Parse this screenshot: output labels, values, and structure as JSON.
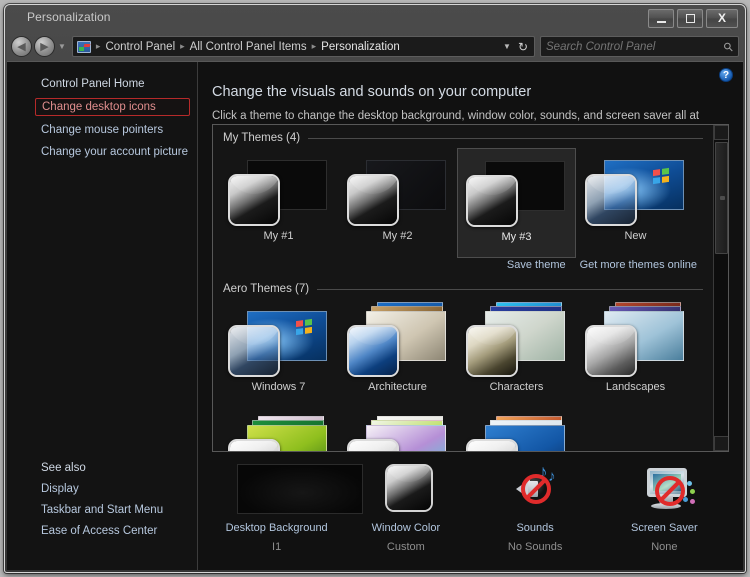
{
  "window": {
    "title": "Personalization",
    "minimize_label": "Minimize",
    "maximize_label": "Maximize",
    "close_label": "Close"
  },
  "address_bar": {
    "back_label": "Back",
    "forward_label": "Forward",
    "recent_pages_label": "Recent pages",
    "crumbs": [
      "Control Panel",
      "All Control Panel Items",
      "Personalization"
    ],
    "separator": "▸",
    "previous_locations_label": "Previous locations",
    "refresh_label": "Refresh",
    "refresh_glyph": "↻"
  },
  "search": {
    "placeholder": "Search Control Panel",
    "value": "",
    "icon_glyph": "⚲"
  },
  "sidebar": {
    "top_items": [
      {
        "label": "Control Panel Home",
        "highlighted": false
      },
      {
        "label": "Change desktop icons",
        "highlighted": true
      },
      {
        "label": "Change mouse pointers",
        "highlighted": false
      },
      {
        "label": "Change your account picture",
        "highlighted": false
      }
    ],
    "see_also_label": "See also",
    "bottom_items": [
      {
        "label": "Display"
      },
      {
        "label": "Taskbar and Start Menu"
      },
      {
        "label": "Ease of Access Center"
      }
    ]
  },
  "content": {
    "help_glyph": "?",
    "title": "Change the visuals and sounds on your computer",
    "subtitle": "Click a theme to change the desktop background, window color, sounds, and screen saver all at once."
  },
  "theme_groups": [
    {
      "heading": "My Themes (4)",
      "themes": [
        {
          "name": "My #1",
          "selected": false,
          "style": "dark-single"
        },
        {
          "name": "My #2",
          "selected": false,
          "style": "dark-textured"
        },
        {
          "name": "My #3",
          "selected": true,
          "style": "dark-single"
        },
        {
          "name": "New",
          "selected": false,
          "style": "win7"
        }
      ],
      "links": [
        {
          "label": "Save theme"
        },
        {
          "label": "Get more themes online"
        }
      ]
    },
    {
      "heading": "Aero Themes (7)",
      "themes": [
        {
          "name": "Windows 7",
          "selected": false,
          "style": "win7"
        },
        {
          "name": "Architecture",
          "selected": false,
          "style": "stack-architecture"
        },
        {
          "name": "Characters",
          "selected": false,
          "style": "stack-characters"
        },
        {
          "name": "Landscapes",
          "selected": false,
          "style": "stack-landscapes"
        }
      ],
      "partial_themes": [
        {
          "name": "",
          "style": "stack-nature"
        },
        {
          "name": "",
          "style": "stack-scenes"
        },
        {
          "name": "",
          "style": "stack-sunset"
        }
      ]
    }
  ],
  "scrollbar": {
    "up_glyph": "▴",
    "down_glyph": "▾"
  },
  "settings": [
    {
      "label": "Desktop Background",
      "value": "I1",
      "icon": "desktop-background-icon"
    },
    {
      "label": "Window Color",
      "value": "Custom",
      "icon": "window-color-icon"
    },
    {
      "label": "Sounds",
      "value": "No Sounds",
      "icon": "sounds-muted-icon"
    },
    {
      "label": "Screen Saver",
      "value": "None",
      "icon": "screen-saver-none-icon"
    }
  ],
  "colors": {
    "accent_link": "#b2c6de",
    "highlight_border": "#b62a2a",
    "window_bg": "#111111",
    "frame": "#3b3b3b"
  }
}
